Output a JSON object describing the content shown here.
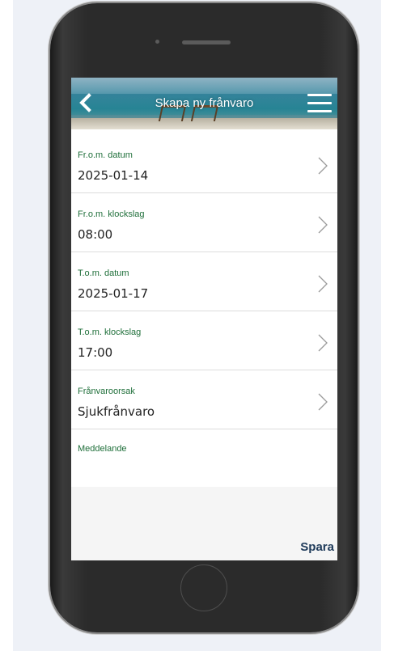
{
  "header": {
    "title": "Skapa ny frånvaro",
    "back_icon": "chevron-left-icon",
    "menu_icon": "hamburger-menu-icon"
  },
  "form": {
    "fields": [
      {
        "label": "Fr.o.m. datum",
        "value": "2025-01-14"
      },
      {
        "label": "Fr.o.m. klockslag",
        "value": "08:00"
      },
      {
        "label": "T.o.m. datum",
        "value": "2025-01-17"
      },
      {
        "label": "T.o.m. klockslag",
        "value": "17:00"
      },
      {
        "label": "Frånvaroorsak",
        "value": "Sjukfrånvaro"
      }
    ],
    "message": {
      "label": "Meddelande",
      "value": ""
    }
  },
  "footer": {
    "save_label": "Spara"
  },
  "colors": {
    "label_green": "#1f6f3a",
    "save_text": "#1f3b5a",
    "phone_body": "#2b2b2b",
    "page_background": "#eef1f7"
  }
}
